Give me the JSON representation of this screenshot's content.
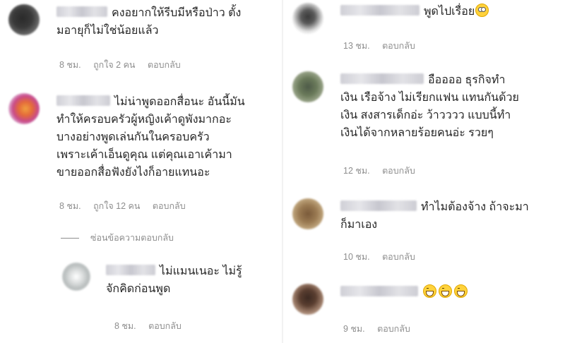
{
  "left_column": {
    "comments": [
      {
        "text": "คงอยากให้รีบมีหรือป่าว ตั้งมอายุก็ไม่ใช่น้อยแล้ว",
        "lines": [
          "คงอยากให้รีบมีหรือป่าว ตั้ง",
          "มอายุก็ไม่ใช่น้อยแล้ว"
        ],
        "time": "8 ชม.",
        "likes": "ถูกใจ 2 คน",
        "reply": "ตอบกลับ"
      },
      {
        "lines": [
          "ไม่น่าพูดออกสื่อนะ อันนี้มัน",
          "ทำให้ครอบครัวผู้หญิงเค้าดูพังมากอะ",
          "บางอย่างพูดเล่นกันในครอบครัว",
          "เพราะเค้าเอ็นดูคุณ แต่คุณเอาเค้ามา",
          "ขายออกสื่อฟังยังไงก็อายแทนอะ"
        ],
        "time": "8 ชม.",
        "likes": "ถูกใจ 12 คน",
        "reply": "ตอบกลับ"
      }
    ],
    "hide_replies": "ซ่อนข้อความตอบกลับ",
    "reply_comment": {
      "lines": [
        "ไม่แมนเนอะ ไม่รู้",
        "จักคิดก่อนพูด"
      ],
      "time": "8 ชม.",
      "reply": "ตอบกลับ"
    }
  },
  "right_column": {
    "comments": [
      {
        "lines": [
          "พูดไปเรื่อย"
        ],
        "emoji": "face-with-rolling-eyes",
        "time": "13 ชม.",
        "reply": "ตอบกลับ"
      },
      {
        "lines": [
          "อืออออ ธุรกิจทำ",
          "เงิน เรือจ้าง ไม่เรียกแฟน แทนกันด้วย",
          "เงิน สงสารเด็กอ่ะ ว้าวววว แบบนี้ทำ",
          "เงินได้จากหลายร้อยคนอ่ะ รวยๆ"
        ],
        "time": "12 ชม.",
        "reply": "ตอบกลับ"
      },
      {
        "lines": [
          "ทำไมต้องจ้าง ถ้าจะมา",
          "ก็มาเอง"
        ],
        "time": "10 ชม.",
        "reply": "ตอบกลับ"
      },
      {
        "lines": [
          ""
        ],
        "emoji": "grinning-face-x3",
        "time": "9 ชม.",
        "reply": "ตอบกลับ"
      }
    ]
  },
  "colors": {
    "text": "#262626",
    "meta": "#8e8e8e",
    "emoji": "#ffd23c"
  }
}
